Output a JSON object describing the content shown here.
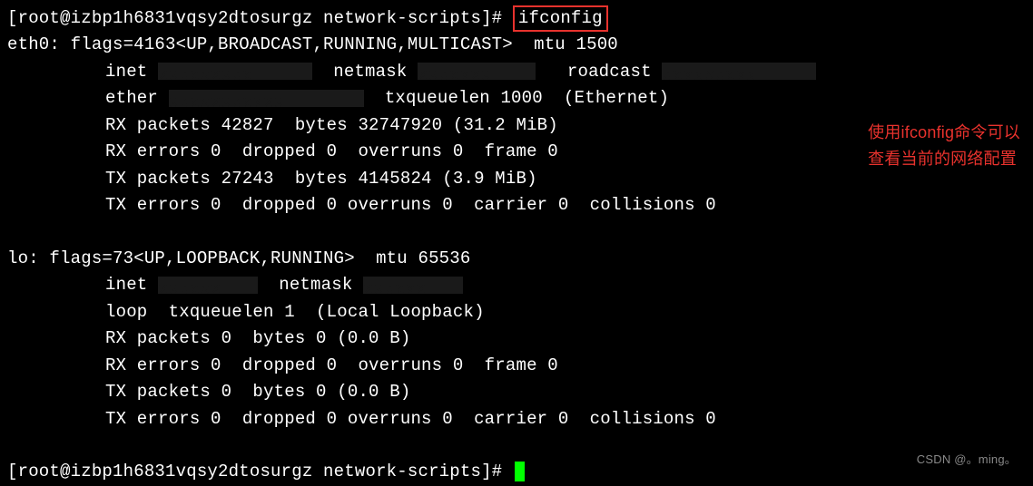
{
  "prompt": {
    "user": "root",
    "host": "izbp1h6831vqsy2dtosurgz",
    "cwd": "network-scripts",
    "symbol": "#",
    "full": "[root@izbp1h6831vqsy2dtosurgz network-scripts]#"
  },
  "command": "ifconfig",
  "eth0": {
    "header": "eth0: flags=4163<UP,BROADCAST,RUNNING,MULTICAST>  mtu 1500",
    "inet_label": "inet ",
    "netmask_label": "  netmask ",
    "broadcast_label": "roadcast ",
    "ether_label": "ether ",
    "txqueuelen": "  txqueuelen 1000  (Ethernet)",
    "rx_packets": "RX packets 42827  bytes 32747920 (31.2 MiB)",
    "rx_errors": "RX errors 0  dropped 0  overruns 0  frame 0",
    "tx_packets": "TX packets 27243  bytes 4145824 (3.9 MiB)",
    "tx_errors": "TX errors 0  dropped 0 overruns 0  carrier 0  collisions 0"
  },
  "lo": {
    "header": "lo: flags=73<UP,LOOPBACK,RUNNING>  mtu 65536",
    "inet_label": "inet ",
    "netmask_label": "  netmask ",
    "loop": "loop  txqueuelen 1  (Local Loopback)",
    "rx_packets": "RX packets 0  bytes 0 (0.0 B)",
    "rx_errors": "RX errors 0  dropped 0  overruns 0  frame 0",
    "tx_packets": "TX packets 0  bytes 0 (0.0 B)",
    "tx_errors": "TX errors 0  dropped 0 overruns 0  carrier 0  collisions 0"
  },
  "annotation": {
    "line1": "使用ifconfig命令可以",
    "line2": "查看当前的网络配置"
  },
  "watermark": "CSDN @。ming。"
}
